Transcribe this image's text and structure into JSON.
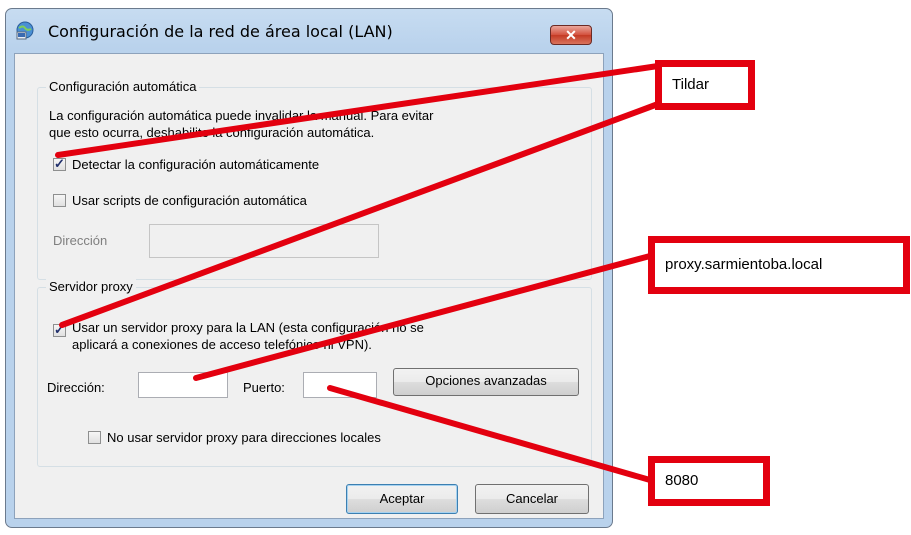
{
  "dialog": {
    "title": "Configuración de la red de área local (LAN)",
    "close_glyph": "✕"
  },
  "auto_group": {
    "title": "Configuración automática",
    "description_line1": "La configuración automática puede invalidar la manual. Para evitar",
    "description_line2": "que esto ocurra, deshabilite la configuración automática.",
    "detect_label": "Detectar la configuración automáticamente",
    "detect_checked": true,
    "scripts_label": "Usar scripts de configuración automática",
    "scripts_checked": false,
    "address_label": "Dirección",
    "address_value": ""
  },
  "proxy_group": {
    "title": "Servidor proxy",
    "use_proxy_line1": "Usar un servidor proxy para la LAN (esta configuración no se",
    "use_proxy_line2": "aplicará a conexiones de acceso telefónico ni VPN).",
    "use_proxy_checked": true,
    "address_label": "Dirección:",
    "address_value": "",
    "port_label": "Puerto:",
    "port_value": "",
    "advanced_button": "Opciones avanzadas",
    "bypass_local_label": "No usar servidor proxy para direcciones locales",
    "bypass_local_checked": false
  },
  "buttons": {
    "ok": "Aceptar",
    "cancel": "Cancelar"
  },
  "annotations": {
    "callout_tildar": "Tildar",
    "callout_proxy": "proxy.sarmientoba.local",
    "callout_port": "8080",
    "accent_color": "#e3000f"
  }
}
